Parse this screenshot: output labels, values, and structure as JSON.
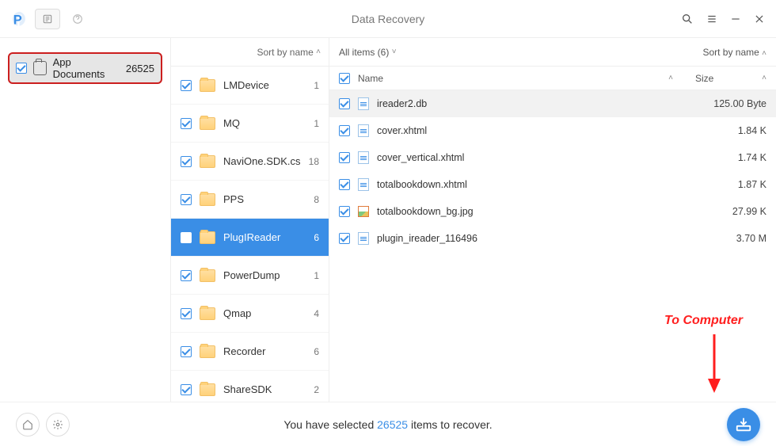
{
  "title": "Data Recovery",
  "appdoc": {
    "label": "App Documents",
    "count": "26525"
  },
  "mid_sort": "Sort by name",
  "folders": [
    {
      "name": "LMDevice",
      "count": "1",
      "selected": false
    },
    {
      "name": "MQ",
      "count": "1",
      "selected": false
    },
    {
      "name": "NaviOne.SDK.cs",
      "count": "18",
      "selected": false
    },
    {
      "name": "PPS",
      "count": "8",
      "selected": false
    },
    {
      "name": "PlugIReader",
      "count": "6",
      "selected": true
    },
    {
      "name": "PowerDump",
      "count": "1",
      "selected": false
    },
    {
      "name": "Qmap",
      "count": "4",
      "selected": false
    },
    {
      "name": "Recorder",
      "count": "6",
      "selected": false
    },
    {
      "name": "ShareSDK",
      "count": "2",
      "selected": false
    }
  ],
  "right": {
    "all_items": "All items (6)",
    "sort": "Sort by name",
    "col_name": "Name",
    "col_size": "Size"
  },
  "files": [
    {
      "name": "ireader2.db",
      "size": "125.00 Byte",
      "type": "doc",
      "selected": true
    },
    {
      "name": "cover.xhtml",
      "size": "1.84 K",
      "type": "doc",
      "selected": false
    },
    {
      "name": "cover_vertical.xhtml",
      "size": "1.74 K",
      "type": "doc",
      "selected": false
    },
    {
      "name": "totalbookdown.xhtml",
      "size": "1.87 K",
      "type": "doc",
      "selected": false
    },
    {
      "name": "totalbookdown_bg.jpg",
      "size": "27.99 K",
      "type": "img",
      "selected": false
    },
    {
      "name": "plugin_ireader_116496",
      "size": "3.70 M",
      "type": "doc",
      "selected": false
    }
  ],
  "footer": {
    "prefix": "You have selected ",
    "count": "26525",
    "suffix": " items to recover."
  },
  "annotation": "To Computer"
}
